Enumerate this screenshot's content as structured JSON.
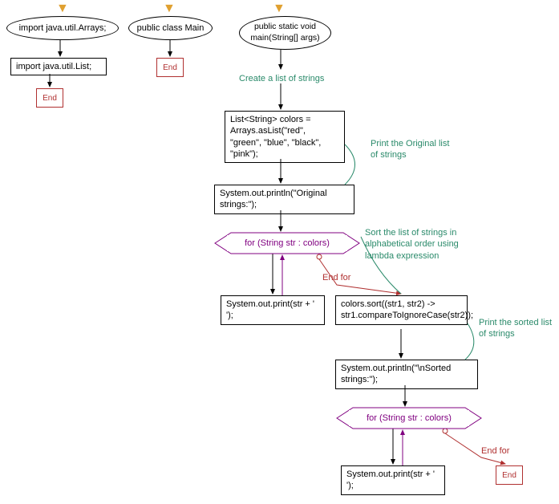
{
  "top": {
    "import_arrays": "import java.util.Arrays;",
    "import_list": "import java.util.List;",
    "class_main": "public class Main",
    "method_main": "public static void main(String[] args)"
  },
  "flow": {
    "comment_create": "Create a list of strings",
    "list_decl": "List<String> colors = Arrays.asList(\"red\", \"green\", \"blue\", \"black\", \"pink\");",
    "comment_print_original": "Print the Original list of strings",
    "println_original": "System.out.println(\"Original strings:\");",
    "for1": "for (String str : colors)",
    "end_for1": "End for",
    "print_str1": "System.out.print(str + ' ');",
    "comment_sort": "Sort the list of strings in alphabetical order using lambda expression",
    "sort_call": "colors.sort((str1, str2) -> str1.compareToIgnoreCase(str2));",
    "comment_print_sorted": "Print the sorted list of strings",
    "println_sorted": "System.out.println(\"\\nSorted strings:\");",
    "for2": "for (String str : colors)",
    "end_for2": "End for",
    "print_str2": "System.out.print(str + ' ');"
  },
  "end_label": "End"
}
